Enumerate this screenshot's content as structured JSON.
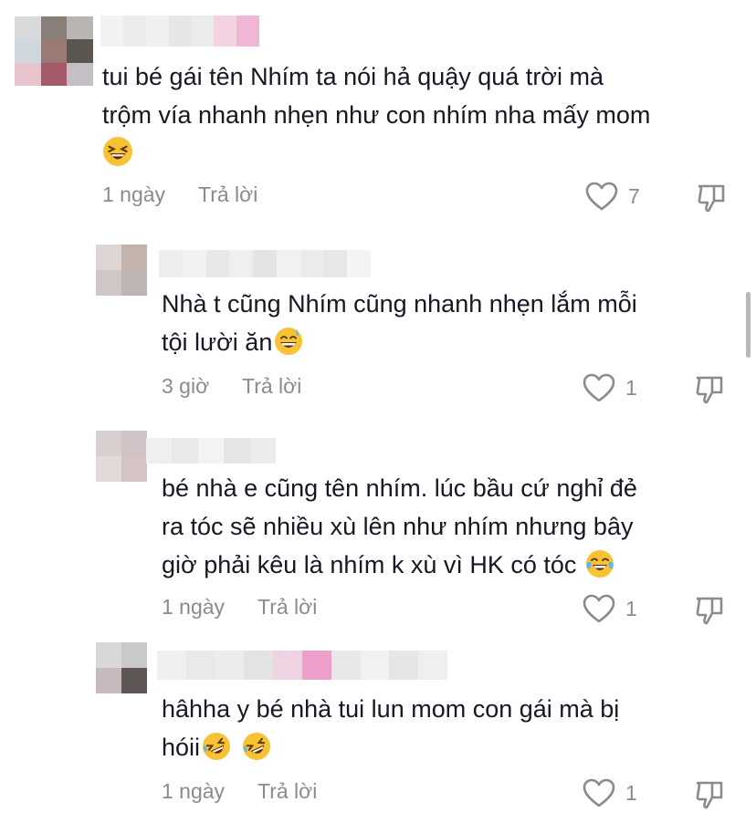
{
  "comments": [
    {
      "text_lines": [
        "tui bé gái tên Nhím ta nói hả quậy quá trời mà",
        "trộm vía nhanh nhẹn như con nhím nha mấy mom",
        ""
      ],
      "emoji": "grinning-squinting",
      "time": "1 ngày",
      "reply": "Trả lời",
      "likes": "7",
      "avatar_colors": [
        "#d8dadc",
        "#8a7f78",
        "#b8b5b2",
        "#cfd8dc",
        "#9a7a72",
        "#5b5650",
        "#e8c4cf",
        "#a65a68",
        "#c4bfc4"
      ],
      "name_colors": [
        "#f2f2f2",
        "#ececec",
        "#f0f0f0",
        "#e6e6e6",
        "#ebebeb",
        "#f3d3e2",
        "#f0b6d5"
      ]
    },
    {
      "text_lines": [
        "Nhà t cũng Nhím cũng nhanh nhẹn lắm mỗi",
        "tội lười ăn"
      ],
      "emoji": "grinning-sweat",
      "time": "3 giờ",
      "reply": "Trả lời",
      "likes": "1",
      "avatar_colors": [
        "#ded6d4",
        "#c4b2ad",
        "#cfc7c5",
        "#bdb4b3"
      ],
      "name_colors": [
        "#eeeeee",
        "#f2f2f2",
        "#e8e8e8",
        "#efefef",
        "#e4e4e4",
        "#f1f1f1",
        "#ebebeb",
        "#e7e7e7",
        "#f4f4f4"
      ]
    },
    {
      "text_lines": [
        "bé nhà e cũng tên nhím. lúc bầu cứ nghỉ đẻ",
        "ra tóc sẽ nhiều xù lên như nhím nhưng bây",
        "giờ phải kêu là nhím k xù vì HK có tóc"
      ],
      "emoji": "tears-of-joy",
      "time": "1 ngày",
      "reply": "Trả lời",
      "likes": "1",
      "avatar_colors": [
        "#d9cfcf",
        "#cfc3c5",
        "#e2d9d9",
        "#d4c4c4"
      ],
      "name_colors": [
        "#efefef",
        "#e9e9e9",
        "#f3f3f3",
        "#e5e5e5",
        "#ececec"
      ]
    },
    {
      "text_lines": [
        "hâhha y bé nhà tui lun mom con gái mà bị",
        "hóii"
      ],
      "emoji": "rofl",
      "time": "1 ngày",
      "reply": "Trả lời",
      "likes": "1",
      "avatar_colors": [
        "#d8d8d8",
        "#c9c9c9",
        "#c7b9bd",
        "#5e5555"
      ],
      "name_colors": [
        "#f0f0f0",
        "#e9e9e9",
        "#ececec",
        "#e3e3e3",
        "#eed3e3",
        "#ee9fcb",
        "#e8e8e8",
        "#f1f1f1",
        "#e6e6e6",
        "#efefef"
      ]
    }
  ]
}
